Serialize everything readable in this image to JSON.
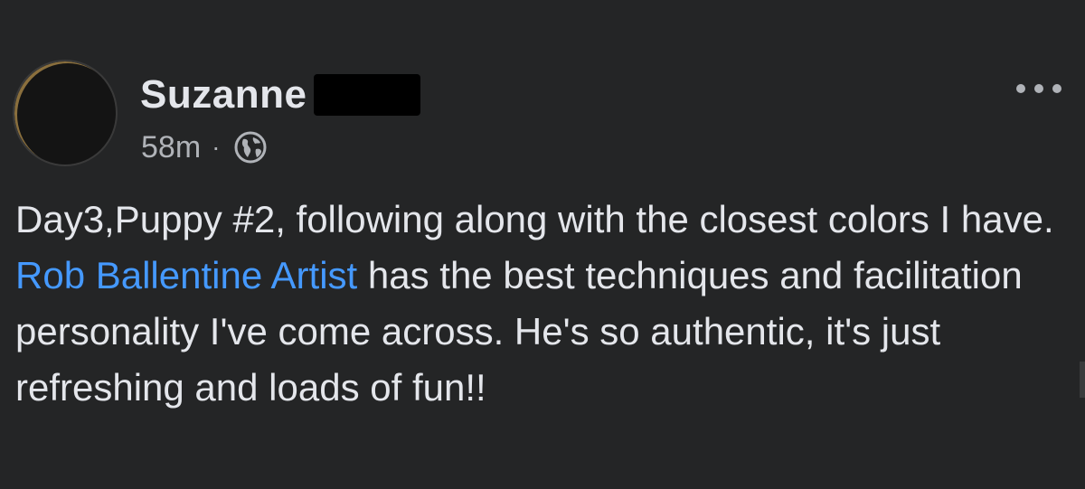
{
  "author": {
    "name": "Suzanne",
    "timestamp": "58m",
    "separator": "·",
    "privacy_icon": "globe-icon"
  },
  "more_options_icon": "ellipsis-icon",
  "post": {
    "text_before_mention": "Day3,Puppy #2, following along with the closest colors I have. ",
    "mention": "Rob Ballentine Artist",
    "text_after_mention": " has the best techniques and facilitation personality I've come across. He's so authentic, it's just refreshing and loads of fun!!"
  },
  "colors": {
    "background": "#242526",
    "primary_text": "#e4e6eb",
    "secondary_text": "#b0b3b8",
    "link": "#4599ff"
  }
}
